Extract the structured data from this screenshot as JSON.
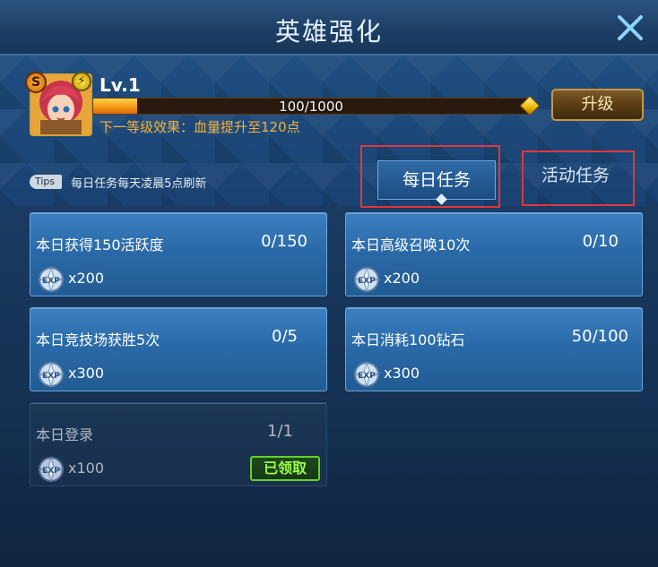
{
  "window": {
    "title": "英雄强化",
    "close_icon": "close-icon"
  },
  "hero": {
    "rank_badge": "S",
    "level": "Lv.1",
    "xp_text": "100/1000",
    "xp_fraction": 0.1,
    "next_effect": "下一等级效果：血量提升至120点",
    "upgrade_label": "升级"
  },
  "tips": {
    "badge": "Tips",
    "text": "每日任务每天凌晨5点刷新"
  },
  "tabs": [
    {
      "label": "每日任务",
      "active": true
    },
    {
      "label": "活动任务",
      "active": false
    }
  ],
  "tasks": [
    {
      "title": "本日获得150活跃度",
      "progress": "0/150",
      "reward": "x200",
      "claimed": false
    },
    {
      "title": "本日高级召唤10次",
      "progress": "0/10",
      "reward": "x200",
      "claimed": false
    },
    {
      "title": "本日竞技场获胜5次",
      "progress": "0/5",
      "reward": "x300",
      "claimed": false
    },
    {
      "title": "本日消耗100钻石",
      "progress": "50/100",
      "reward": "x300",
      "claimed": false
    },
    {
      "title": "本日登录",
      "progress": "1/1",
      "reward": "x100",
      "claimed": true,
      "claimed_label": "已领取"
    }
  ],
  "colors": {
    "accent_gold": "#f5b33a",
    "highlight_red": "#e0373c",
    "claimed_green": "#9cff4a"
  }
}
